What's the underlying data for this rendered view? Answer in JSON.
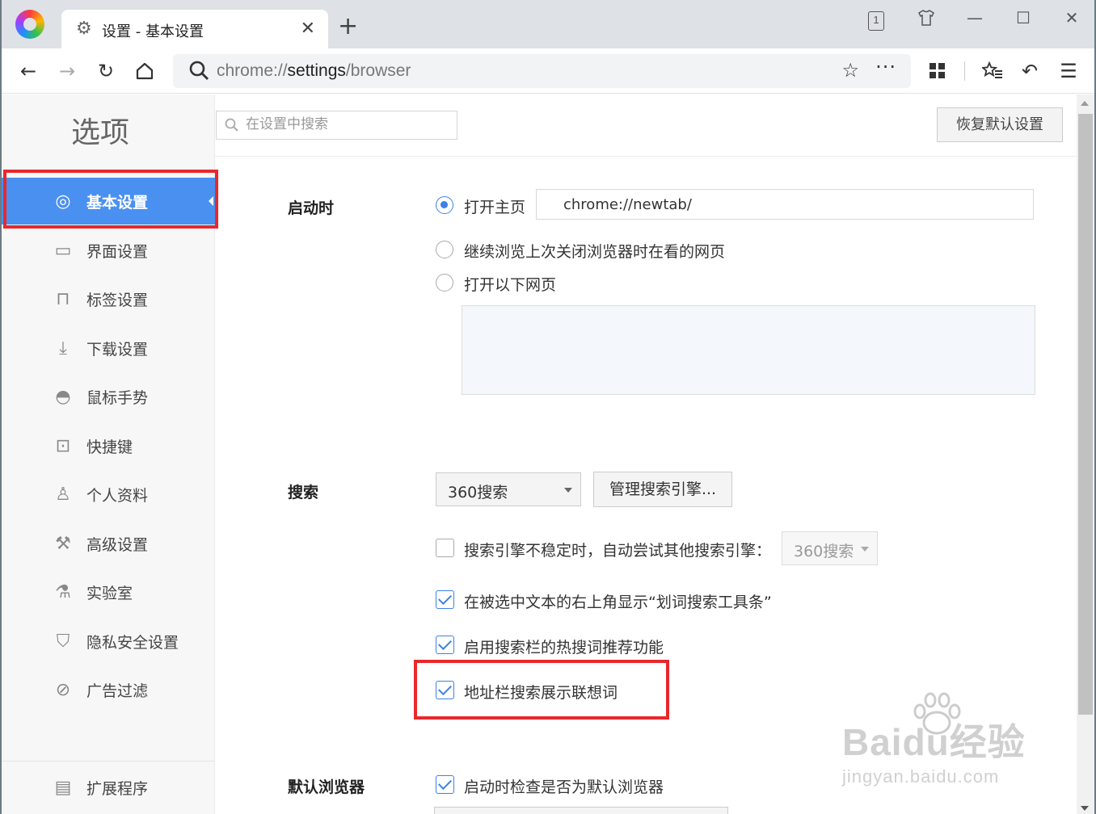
{
  "browser": {
    "tab_title": "设置 - 基本设置",
    "window_badge": "1",
    "url_prefix": "chrome://",
    "url_host": "settings",
    "url_path": "/browser"
  },
  "page": {
    "title": "选项",
    "search_placeholder": "在设置中搜索",
    "reset_button": "恢复默认设置"
  },
  "sidebar": {
    "items": [
      {
        "label": "基本设置",
        "icon": "basic-settings-icon"
      },
      {
        "label": "界面设置",
        "icon": "window-icon"
      },
      {
        "label": "标签设置",
        "icon": "tab-icon"
      },
      {
        "label": "下载设置",
        "icon": "download-icon"
      },
      {
        "label": "鼠标手势",
        "icon": "mouse-icon"
      },
      {
        "label": "快捷键",
        "icon": "shortcut-icon"
      },
      {
        "label": "个人资料",
        "icon": "user-icon"
      },
      {
        "label": "高级设置",
        "icon": "wrench-icon"
      },
      {
        "label": "实验室",
        "icon": "flask-icon"
      },
      {
        "label": "隐私安全设置",
        "icon": "shield-icon"
      },
      {
        "label": "广告过滤",
        "icon": "block-icon"
      }
    ],
    "extensions": {
      "label": "扩展程序",
      "icon": "extensions-icon"
    },
    "active_index": 0
  },
  "startup": {
    "title": "启动时",
    "open_home": "打开主页",
    "home_url": "chrome://newtab/",
    "continue_last": "继续浏览上次关闭浏览器时在看的网页",
    "open_pages": "打开以下网页",
    "selected": "open_home"
  },
  "search": {
    "title": "搜索",
    "engine": "360搜索",
    "manage_button": "管理搜索引擎...",
    "fallback_label": "搜索引擎不稳定时，自动尝试其他搜索引擎：",
    "fallback_engine": "360搜索",
    "fallback_checked": false,
    "show_toolbar_label": "在被选中文本的右上角显示“划词搜索工具条”",
    "show_toolbar_checked": true,
    "hot_words_label": "启用搜索栏的热搜词推荐功能",
    "hot_words_checked": true,
    "suggest_label": "地址栏搜索展示联想词",
    "suggest_checked": true
  },
  "default_browser": {
    "title": "默认浏览器",
    "check_label": "启动时检查是否为默认浏览器",
    "check_checked": true
  },
  "watermark": {
    "main": "Baidu经验",
    "sub": "jingyan.baidu.com"
  },
  "colors": {
    "accent": "#4a90f0",
    "highlight_box": "#e8282b"
  }
}
